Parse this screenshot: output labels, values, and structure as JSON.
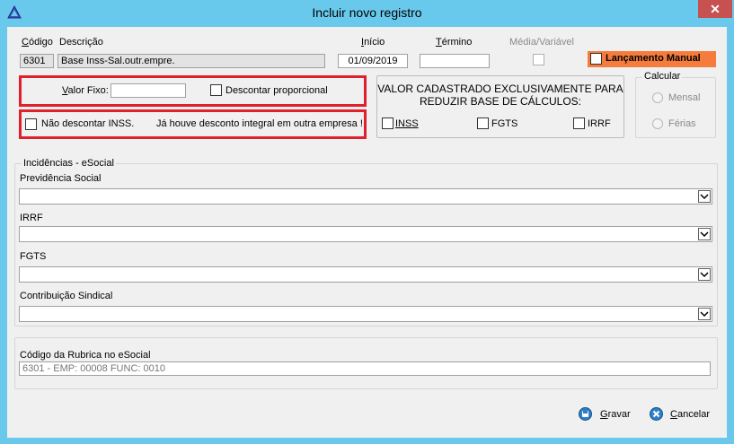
{
  "window": {
    "title": "Incluir novo registro",
    "close_glyph": "✕",
    "app_icon": "delta-icon"
  },
  "header": {
    "codigo_label": "Código",
    "descricao_label": "Descrição",
    "inicio_label": "Início",
    "termino_label": "Término",
    "media_label": "Média/Variável",
    "codigo_value": "6301",
    "descricao_value": "Base Inss-Sal.outr.empre.",
    "inicio_value": "01/09/2019",
    "termino_value": "",
    "lancamento_label": "Lançamento Manual",
    "lancamento_color": "#f57c3c"
  },
  "valor": {
    "valor_fixo_label": "Valor Fixo:",
    "valor_fixo_value": "",
    "descontar_label": "Descontar proporcional",
    "nao_descontar_label": "Não descontar INSS.",
    "desconto_note": "Já houve desconto integral em outra empresa !",
    "highlight_color": "#e0202a"
  },
  "reducao": {
    "title_line1": "VALOR CADASTRADO EXCLUSIVAMENTE PARA",
    "title_line2": "REDUZIR BASE DE CÁLCULOS:",
    "inss_label": "INSS",
    "fgts_label": "FGTS",
    "irrf_label": "IRRF"
  },
  "calcular": {
    "title": "Calcular",
    "mensal_label": "Mensal",
    "ferias_label": "Férias"
  },
  "incidencias": {
    "title": "Incidências - eSocial",
    "previdencia_label": "Previdência Social",
    "irrf_label": "IRRF",
    "fgts_label": "FGTS",
    "sindical_label": "Contribuição Sindical"
  },
  "rubrica": {
    "label": "Código da Rubrica no eSocial",
    "value": "6301 - EMP: 00008 FUNC: 0010"
  },
  "footer": {
    "gravar_label": "Gravar",
    "cancelar_label": "Cancelar"
  }
}
